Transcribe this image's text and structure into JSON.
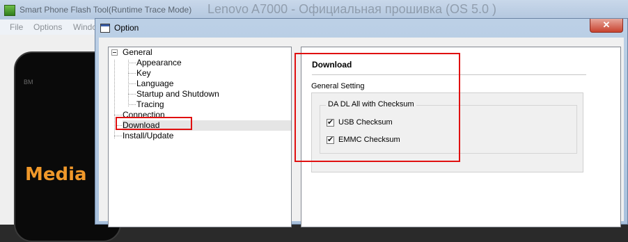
{
  "background_app": {
    "title": "Smart Phone Flash Tool(Runtime Trace Mode)",
    "overlay_title": "Lenovo A7000 - Официальная прошивка (OS 5.0 )",
    "menu": [
      "File",
      "Options",
      "Windo"
    ],
    "phone_brand": "BM",
    "phone_text": "Media"
  },
  "dialog": {
    "title": "Option",
    "close_label": "✕",
    "tree": {
      "items": [
        {
          "label": "General"
        },
        {
          "label": "Appearance"
        },
        {
          "label": "Key"
        },
        {
          "label": "Language"
        },
        {
          "label": "Startup and Shutdown"
        },
        {
          "label": "Tracing"
        },
        {
          "label": "Connection"
        },
        {
          "label": "Download"
        },
        {
          "label": "Install/Update"
        }
      ],
      "selected": "Download"
    },
    "panel": {
      "title": "Download",
      "section_label": "General Setting",
      "groupbox_label": "DA DL All with Checksum",
      "checkboxes": [
        {
          "label": "USB Checksum",
          "checked": true
        },
        {
          "label": "EMMC Checksum",
          "checked": true
        }
      ]
    }
  },
  "annotation_color": "#e01010",
  "check_glyph": "✔"
}
